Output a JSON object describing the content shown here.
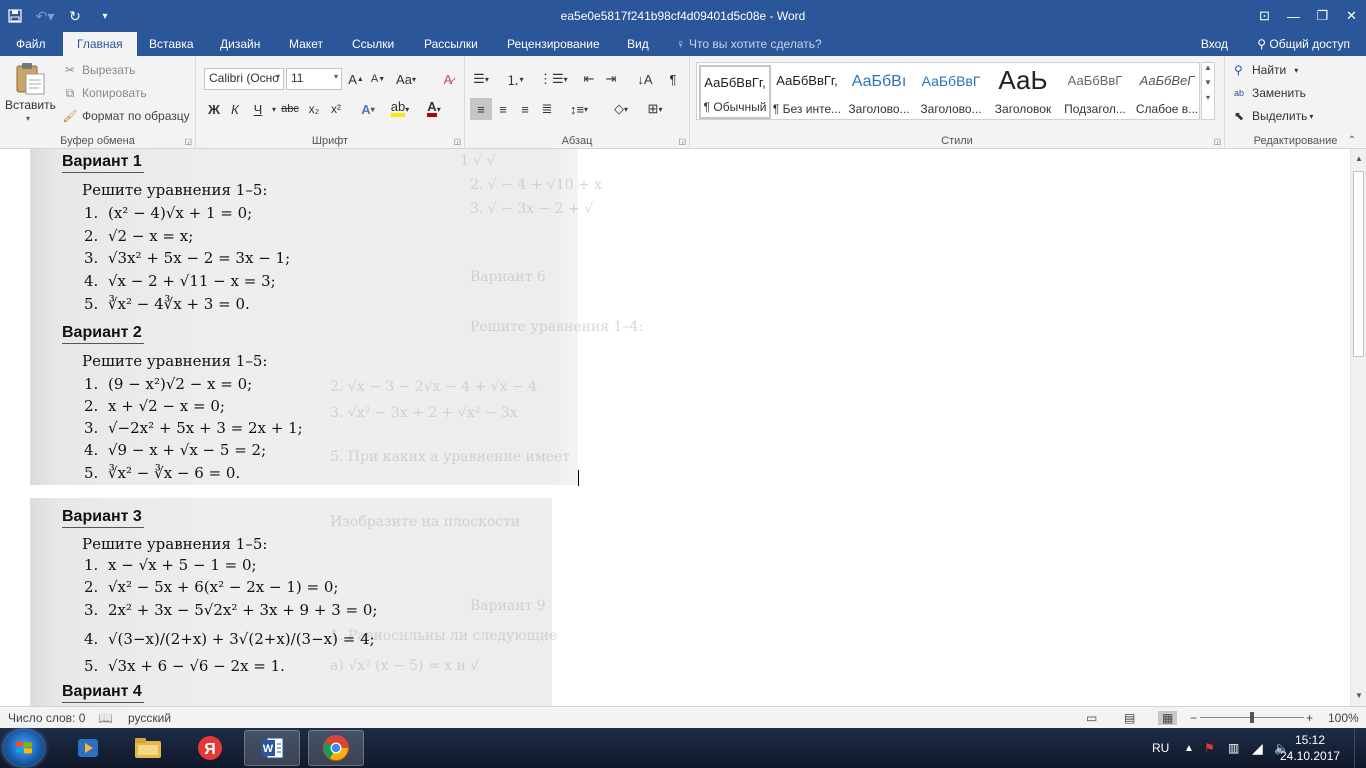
{
  "window": {
    "title": "ea5e0e5817f241b98cf4d09401d5c08e - Word"
  },
  "tabs": [
    {
      "label": "Файл"
    },
    {
      "label": "Главная"
    },
    {
      "label": "Вставка"
    },
    {
      "label": "Дизайн"
    },
    {
      "label": "Макет"
    },
    {
      "label": "Ссылки"
    },
    {
      "label": "Рассылки"
    },
    {
      "label": "Рецензирование"
    },
    {
      "label": "Вид"
    }
  ],
  "tell_me": {
    "placeholder": "Что вы хотите сделать?"
  },
  "account": {
    "signin": "Вход",
    "share": "Общий доступ"
  },
  "ribbon": {
    "clipboard": {
      "paste": "Вставить",
      "cut": "Вырезать",
      "copy": "Копировать",
      "format_painter": "Формат по образцу",
      "label": "Буфер обмена"
    },
    "font": {
      "font_name": "Calibri (Осно",
      "font_size": "11",
      "bold": "Ж",
      "italic": "К",
      "underline": "Ч",
      "strike": "abc",
      "subscript": "x₂",
      "superscript": "x²",
      "case": "Aa",
      "label": "Шрифт"
    },
    "paragraph": {
      "label": "Абзац"
    },
    "styles": {
      "items": [
        {
          "sample": "АаБбВвГг,",
          "name": "¶ Обычный"
        },
        {
          "sample": "АаБбВвГг,",
          "name": "¶ Без инте..."
        },
        {
          "sample": "АаБбВı",
          "name": "Заголово..."
        },
        {
          "sample": "АаБбВвГ",
          "name": "Заголово..."
        },
        {
          "sample": "АаЬ",
          "name": "Заголовок"
        },
        {
          "sample": "АаБбВвГ",
          "name": "Подзагол..."
        },
        {
          "sample": "АаБбВеГ",
          "name": "Слабое в..."
        }
      ],
      "label": "Стили"
    },
    "editing": {
      "find": "Найти",
      "replace": "Заменить",
      "select": "Выделить",
      "label": "Редактирование"
    }
  },
  "document": {
    "variants": [
      {
        "title": "Вариант 1",
        "task": "Решите уравнения 1–5:",
        "equations": [
          {
            "n": "1.",
            "text": "(x² − 4)√x + 1 = 0;"
          },
          {
            "n": "2.",
            "text": "√2 − x = x;"
          },
          {
            "n": "3.",
            "text": "√3x² + 5x − 2 = 3x − 1;"
          },
          {
            "n": "4.",
            "text": "√x − 2 + √11 − x = 3;"
          },
          {
            "n": "5.",
            "text": "∛x² − 4∛x + 3 = 0."
          }
        ]
      },
      {
        "title": "Вариант 2",
        "task": "Решите уравнения 1–5:",
        "equations": [
          {
            "n": "1.",
            "text": "(9 − x²)√2 − x = 0;"
          },
          {
            "n": "2.",
            "text": "x + √2 − x = 0;"
          },
          {
            "n": "3.",
            "text": "√−2x² + 5x + 3 = 2x + 1;"
          },
          {
            "n": "4.",
            "text": "√9 − x + √x − 5 = 2;"
          },
          {
            "n": "5.",
            "text": "∛x² − ∛x − 6 = 0."
          }
        ]
      },
      {
        "title": "Вариант 3",
        "task": "Решите уравнения 1–5:",
        "equations": [
          {
            "n": "1.",
            "text": "x − √x + 5 − 1 = 0;"
          },
          {
            "n": "2.",
            "text": "√x² − 5x + 6(x² − 2x − 1) = 0;"
          },
          {
            "n": "3.",
            "text": "2x² + 3x − 5√2x² + 3x + 9 + 3 = 0;"
          },
          {
            "n": "4.",
            "text": "√(3−x)/(2+x) + 3√(2+x)/(3−x) = 4;"
          },
          {
            "n": "5.",
            "text": "√3x + 6 − √6 − 2x = 1."
          }
        ]
      },
      {
        "title": "Вариант 4"
      }
    ]
  },
  "status": {
    "words": "Число слов: 0",
    "language": "русский",
    "zoom": "100%",
    "zoom_level": 1.0
  },
  "taskbar": {
    "lang": "RU",
    "time": "15:12",
    "date": "24.10.2017"
  },
  "colors": {
    "accent": "#2b579a",
    "ribbon_bg": "#f3f3f3",
    "taskbar": "#14203a"
  }
}
